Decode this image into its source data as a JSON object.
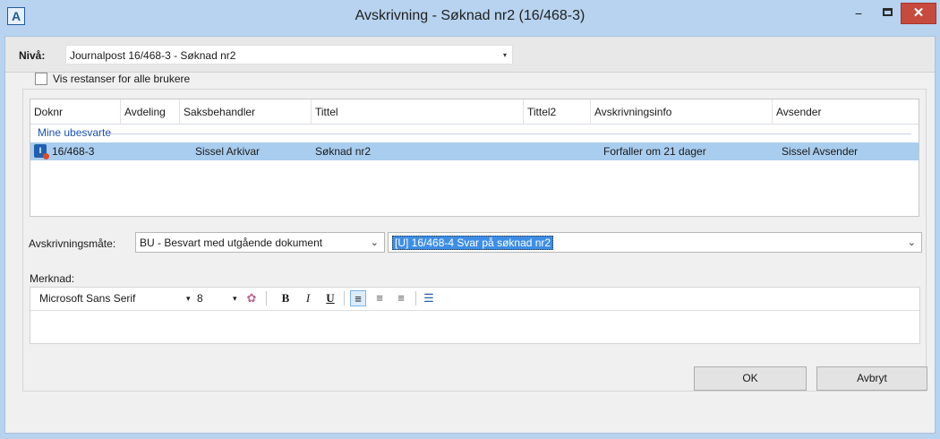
{
  "window": {
    "app_icon_glyph": "A",
    "title": "Avskrivning - Søknad nr2 (16/468-3)",
    "minimize_glyph": "−",
    "close_glyph": "✕"
  },
  "level": {
    "label": "Nivå:",
    "value": "Journalpost 16/468-3 - Søknad nr2",
    "arrow": "▾"
  },
  "show_all": {
    "label": "Vis restanser for alle brukere",
    "checked": false
  },
  "list": {
    "columns": [
      "Doknr",
      "Avdeling",
      "Saksbehandler",
      "Tittel",
      "Tittel2",
      "Avskrivningsinfo",
      "Avsender"
    ],
    "group_label": "Mine ubesvarte",
    "rows": [
      {
        "icon": "document-incoming-icon",
        "icon_glyph": "I",
        "doknr": "16/468-3",
        "avdeling": "",
        "saksbehandler": "Sissel Arkivar",
        "tittel": "Søknad nr2",
        "tittel2": "",
        "avskrivningsinfo": "Forfaller om 21 dager",
        "avsender": "Sissel Avsender",
        "selected": true
      }
    ]
  },
  "method": {
    "label": "Avskrivningsmåte:",
    "value": "BU - Besvart med utgående dokument",
    "arrow": "⌄",
    "document_value": "[U] 16/468-4 Svar på søknad nr2",
    "document_arrow": "⌄"
  },
  "remark": {
    "label": "Merknad:",
    "font_name": "Microsoft Sans Serif",
    "font_size": "8",
    "dropdown_glyph": "▾",
    "bold": "B",
    "italic": "I",
    "underline": "U",
    "align_left_glyph": "≡",
    "align_center_glyph": "≡",
    "align_right_glyph": "≡",
    "bullets_glyph": "☰",
    "color_glyph": "✿"
  },
  "buttons": {
    "ok": "OK",
    "cancel": "Avbryt"
  },
  "colors": {
    "title_bar": "#b7d3ef",
    "selection": "#a9cdee",
    "group_text": "#1a52b3",
    "close_button": "#c74a3e"
  }
}
